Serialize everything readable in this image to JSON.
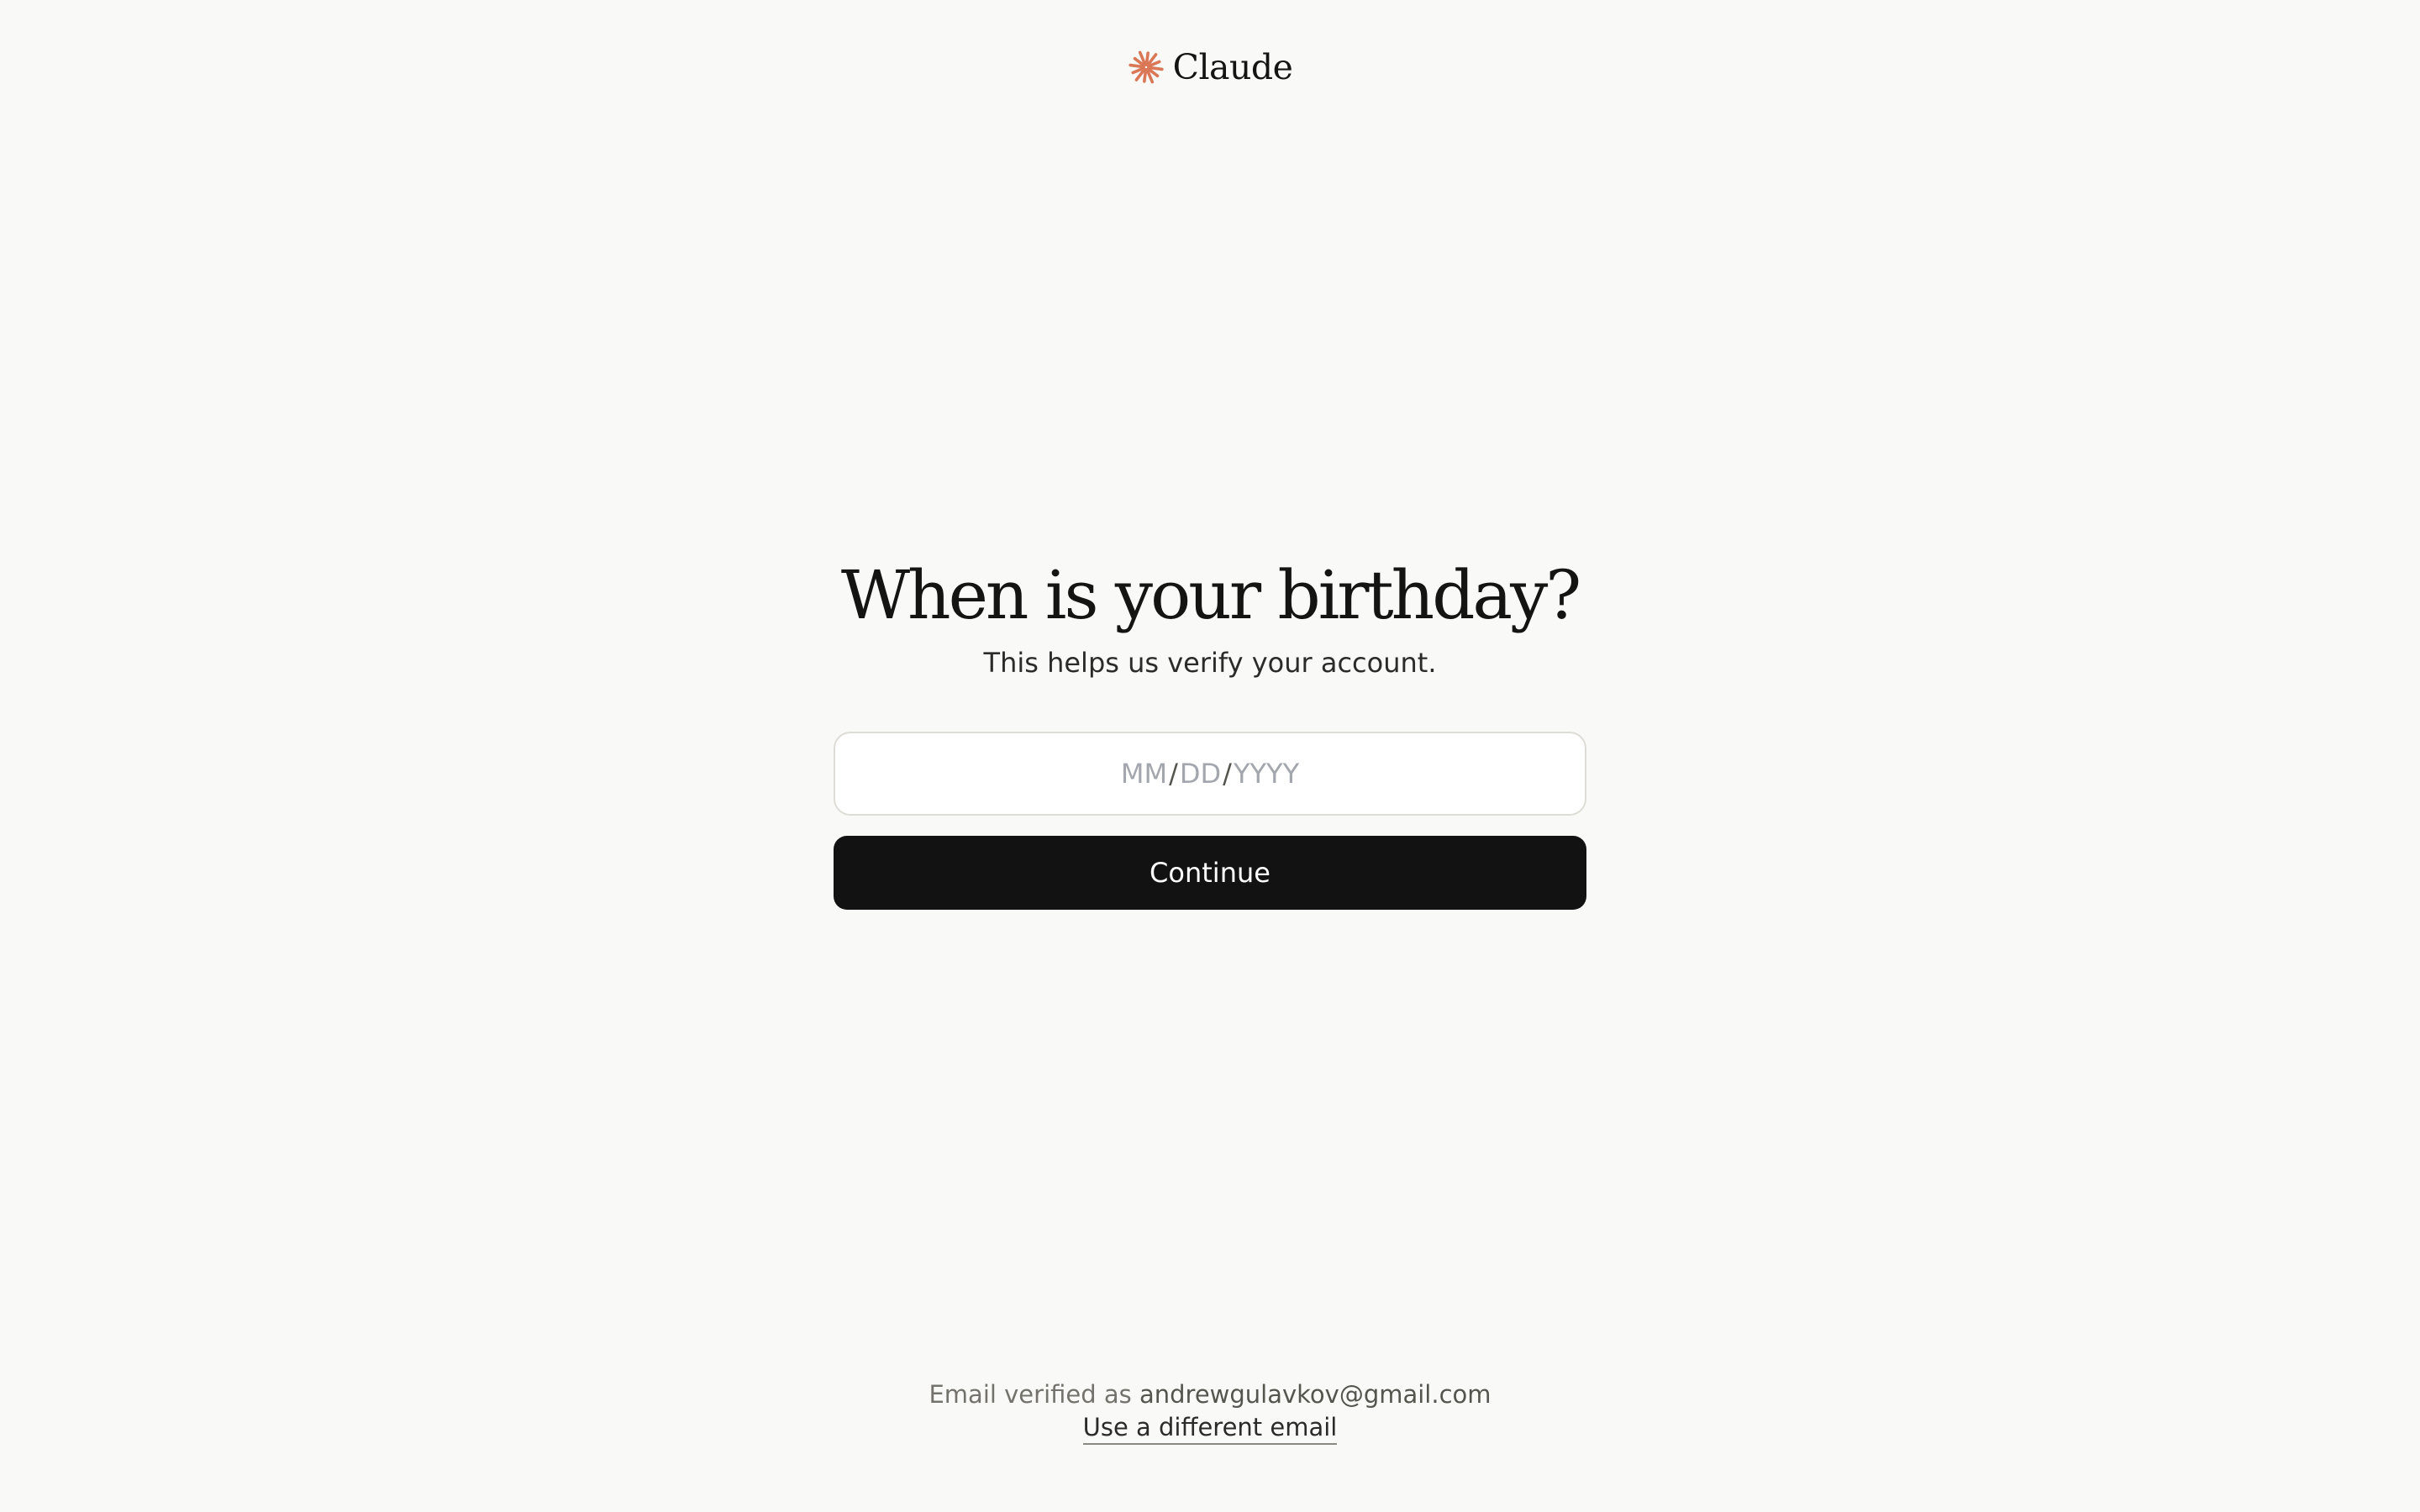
{
  "brand": {
    "name": "Claude",
    "icon": "claude-sunburst-icon",
    "icon_color": "#d97757"
  },
  "main": {
    "title": "When is your birthday?",
    "subtitle": "This helps us verify your account."
  },
  "birthday_input": {
    "month_placeholder": "MM",
    "day_placeholder": "DD",
    "year_placeholder": "YYYY",
    "separator": "/"
  },
  "continue_button": {
    "label": "Continue",
    "background": "#121212"
  },
  "footer": {
    "verified_prefix": "Email verified as",
    "email": "andrewgulavkov@gmail.com",
    "change_email_link": "Use a different email"
  }
}
